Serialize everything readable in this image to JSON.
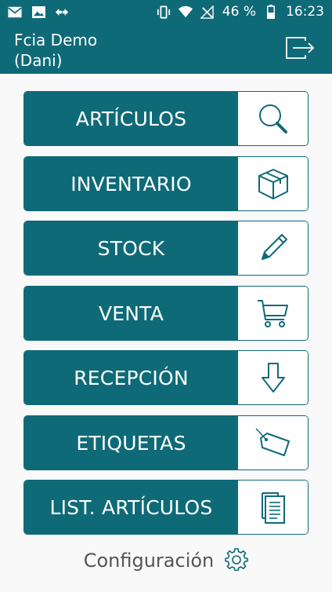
{
  "status_bar": {
    "battery": "46 %",
    "time": "16:23"
  },
  "app_bar": {
    "title_line1": "Fcia Demo",
    "title_line2": "(Dani)",
    "logout_icon": "logout-icon"
  },
  "menu": [
    {
      "label": "ARTÍCULOS",
      "icon": "search-icon"
    },
    {
      "label": "INVENTARIO",
      "icon": "box-icon"
    },
    {
      "label": "STOCK",
      "icon": "pencil-icon"
    },
    {
      "label": "VENTA",
      "icon": "cart-icon"
    },
    {
      "label": "RECEPCIÓN",
      "icon": "arrow-down-icon"
    },
    {
      "label": "ETIQUETAS",
      "icon": "tag-icon"
    },
    {
      "label": "LIST. ARTÍCULOS",
      "icon": "document-list-icon"
    }
  ],
  "config": {
    "label": "Configuración",
    "icon": "gear-icon"
  },
  "colors": {
    "primary": "#0f6a78",
    "background": "#f9f9f9"
  }
}
